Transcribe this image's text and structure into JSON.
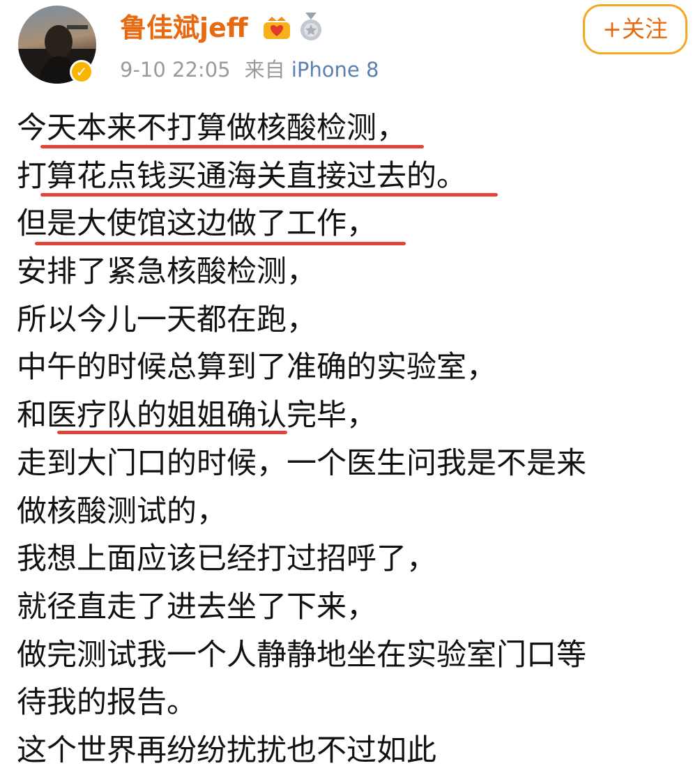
{
  "post": {
    "author": {
      "name": "鲁佳斌jeff",
      "verified_icon": "verified-v-icon",
      "vip_icon": "vip-crown-icon",
      "medal_icon": "medal-icon"
    },
    "time": "9-10 22:05",
    "source_prefix": "来自",
    "source_device": "iPhone 8",
    "follow_label": "+关注",
    "lines": [
      "今天本来不打算做核酸检测，",
      "打算花点钱买通海关直接过去的。",
      "但是大使馆这边做了工作，",
      "安排了紧急核酸检测，",
      "所以今儿一天都在跑，",
      "中午的时候总算到了准确的实验室，",
      "和医疗队的姐姐确认完毕，",
      "走到大门口的时候，一个医生问我是不是来",
      "做核酸测试的，",
      "我想上面应该已经打过招呼了，",
      "就径直走了进去坐了下来，",
      "做完测试我一个人静静地坐在实验室门口等",
      "待我的报告。",
      "这个世界再纷纷扰扰也不过如此"
    ]
  },
  "colors": {
    "name": "#e86a10",
    "meta": "#9a9a9a",
    "device": "#5b7fb0",
    "follow_border": "#f5a623",
    "underline": "#e2433a",
    "verified_badge": "#f7b500"
  }
}
